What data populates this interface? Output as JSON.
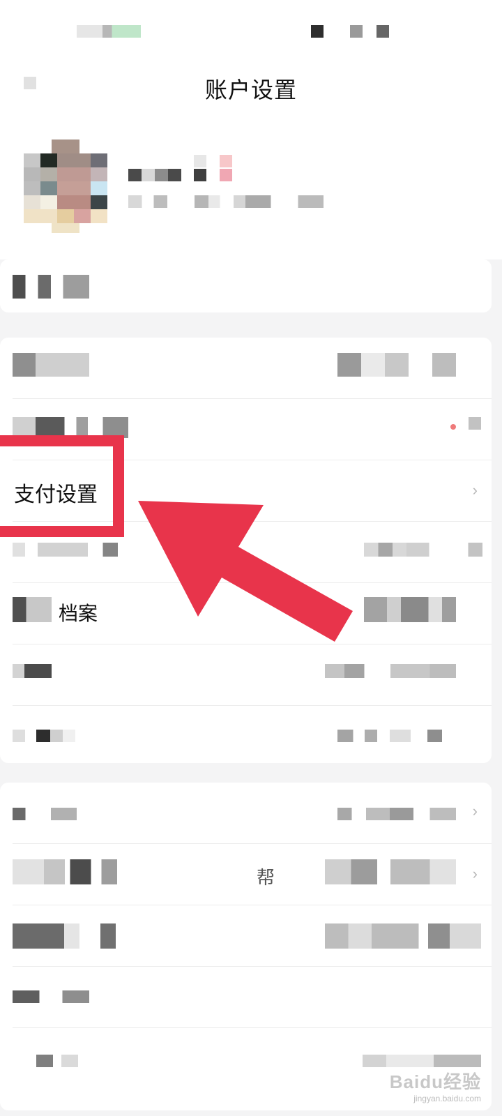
{
  "header": {
    "title": "账户设置"
  },
  "rows": [
    {
      "label": ""
    },
    {
      "label": "支付设置",
      "chevron": "›"
    },
    {
      "label": "档案",
      "chevron": ""
    },
    {
      "label": "帮",
      "chevron": "›"
    }
  ],
  "annotation": {
    "arrow_color": "#e8344b",
    "highlight_color": "#e8344b"
  },
  "watermark": {
    "logo": "Baidu经验",
    "url": "jingyan.baidu.com"
  },
  "icons": {
    "back": "chevron-left-icon",
    "chevron": "chevron-right-icon"
  }
}
